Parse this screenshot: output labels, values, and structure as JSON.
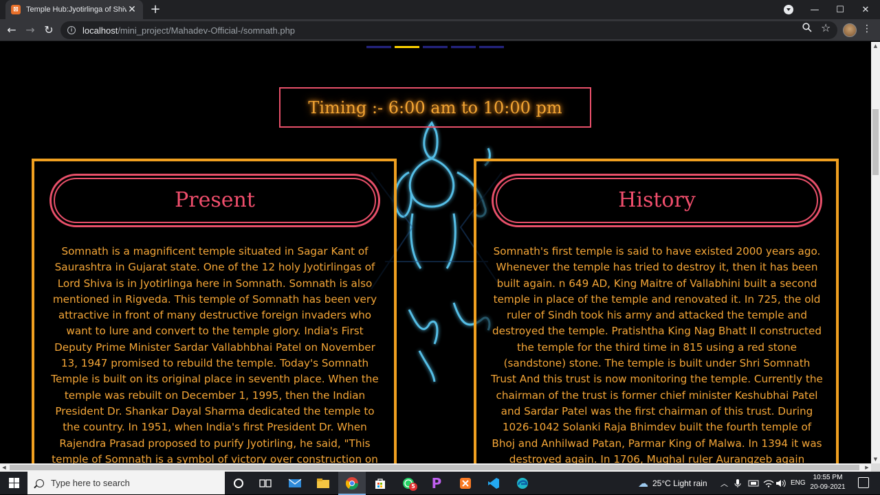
{
  "browser": {
    "tab_title": "Temple Hub:Jyotirlinga of Shiva",
    "favicon": "xampp-icon",
    "url_host": "localhost",
    "url_path": "/mini_project/Mahadev-Official-/somnath.php"
  },
  "page": {
    "carousel": {
      "count": 5,
      "active_index": 1
    },
    "timing": "Timing :- 6:00 am to 10:00 pm",
    "present": {
      "heading": "Present",
      "text": "Somnath is a magnificent temple situated in Sagar Kant of Saurashtra in Gujarat state. One of the 12 holy Jyotirlingas of Lord Shiva is in Jyotirlinga here in Somnath. Somnath is also mentioned in Rigveda. This temple of Somnath has been very attractive in front of many destructive foreign invaders who want to lure and convert to the temple glory. India's First Deputy Prime Minister Sardar Vallabhbhai Patel on November 13, 1947 promised to rebuild the temple. Today's Somnath Temple is built on its original place in seventh place. When the temple was rebuilt on December 1, 1995, then the Indian President Dr. Shankar Dayal Sharma dedicated the temple to the country. In 1951, when India's first President Dr. When Rajendra Prasad proposed to purify Jyotirling, he said, \"This temple of Somnath is a symbol of victory over construction on destruction\""
    },
    "history": {
      "heading": "History",
      "text": "Somnath's first temple is said to have existed 2000 years ago. Whenever the temple has tried to destroy it, then it has been built again. n 649 AD, King Maitre of Vallabhini built a second temple in place of the temple and renovated it. In 725, the old ruler of Sindh took his army and attacked the temple and destroyed the temple. Pratishtha King Nag Bhatt II constructed the temple for the third time in 815 using a red stone (sandstone) stone. The temple is built under Shri Somnath Trust And this trust is now monitoring the temple. Currently the chairman of the trust is former chief minister Keshubhai Patel and Sardar Patel was the first chairman of this trust. During 1026-1042 Solanki Raja Bhimdev built the fourth temple of Bhoj and Anhilwad Patan, Parmar King of Malwa. In 1394 it was destroyed again. In 1706, Mughal ruler Aurangzeb again"
    }
  },
  "taskbar": {
    "search_placeholder": "Type here to search",
    "whatsapp_badge": "5",
    "weather": "25°C  Light rain",
    "language": "ENG",
    "time": "10:55 PM",
    "date": "20-09-2021"
  },
  "colors": {
    "accent_orange": "#f0a020",
    "accent_pink": "#e8506a",
    "text_orange": "#f6a737",
    "carousel_active": "#ffd400",
    "carousel_inactive": "#3b3bd0"
  }
}
